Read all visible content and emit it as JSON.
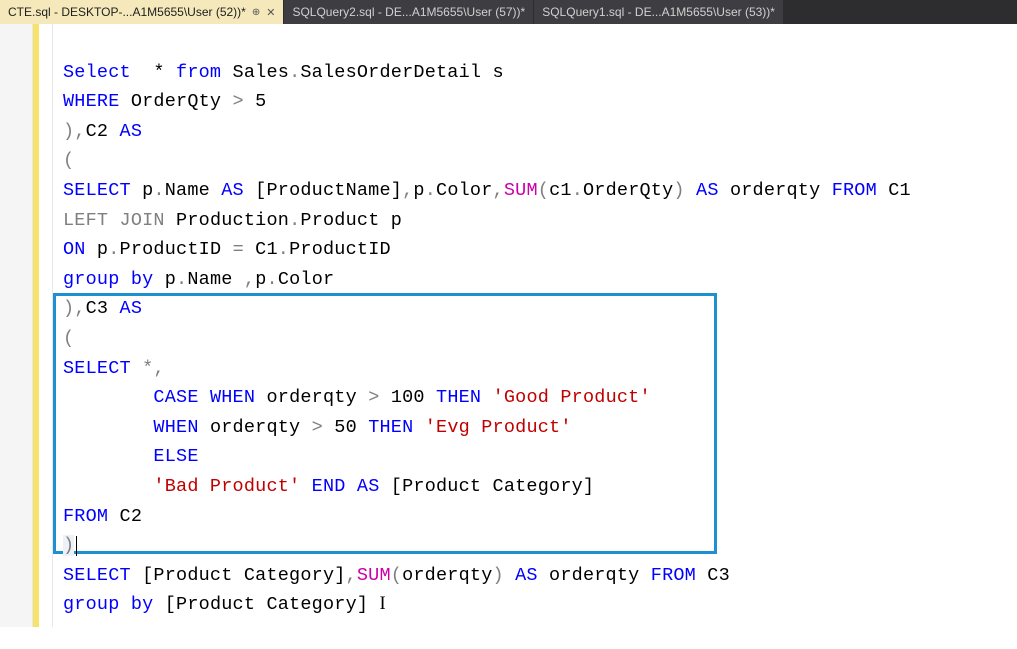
{
  "tabs": [
    {
      "label": "CTE.sql - DESKTOP-...A1M5655\\User (52))*",
      "active": true,
      "pinned": true,
      "closable": true
    },
    {
      "label": "SQLQuery2.sql - DE...A1M5655\\User (57))*",
      "active": false,
      "pinned": false,
      "closable": false
    },
    {
      "label": "SQLQuery1.sql - DE...A1M5655\\User (53))*",
      "active": false,
      "pinned": false,
      "closable": false
    }
  ],
  "code": {
    "l0": {
      "a": "Select",
      "b": "  * ",
      "c": "from",
      "d": " Sales",
      "e": ".",
      "f": "SalesOrderDetail s"
    },
    "l1": {
      "a": "WHERE",
      "b": " OrderQty ",
      "c": ">",
      "d": " 5"
    },
    "l2": {
      "a": ")",
      "b": ",",
      "c": "C2 ",
      "d": "AS"
    },
    "l3": {
      "a": "("
    },
    "l4": {
      "a": "SELECT",
      "b": " p",
      "c": ".",
      "d": "Name ",
      "e": "AS",
      "f": " [ProductName]",
      "g": ",",
      "h": "p",
      "i": ".",
      "j": "Color",
      "k": ",",
      "l": "SUM",
      "m": "(",
      "n": "c1",
      "o": ".",
      "p": "OrderQty",
      "q": ")",
      "r": " ",
      "s": "AS",
      "t": " orderqty ",
      "u": "FROM",
      "v": " C1"
    },
    "l5": {
      "a": "LEFT",
      "b": " ",
      "c": "JOIN",
      "d": " Production",
      "e": ".",
      "f": "Product p"
    },
    "l6": {
      "a": "ON",
      "b": " p",
      "c": ".",
      "d": "ProductID ",
      "e": "=",
      "f": " C1",
      "g": ".",
      "h": "ProductID"
    },
    "l7": {
      "a": "group",
      "b": " ",
      "c": "by",
      "d": " p",
      "e": ".",
      "f": "Name ",
      "g": ",",
      "h": "p",
      "i": ".",
      "j": "Color"
    },
    "l8": {
      "a": ")",
      "b": ",",
      "c": "C3 ",
      "d": "AS"
    },
    "l9": {
      "a": "("
    },
    "l10": {
      "a": "SELECT",
      "b": " ",
      "c": "*",
      "d": ","
    },
    "l11": {
      "a": "        ",
      "b": "CASE",
      "c": " ",
      "d": "WHEN",
      "e": " orderqty ",
      "f": ">",
      "g": " 100 ",
      "h": "THEN",
      "i": " ",
      "j": "'Good Product'"
    },
    "l12": {
      "a": "        ",
      "b": "WHEN",
      "c": " orderqty ",
      "d": ">",
      "e": " 50 ",
      "f": "THEN",
      "g": " ",
      "h": "'Evg Product'"
    },
    "l13": {
      "a": "        ",
      "b": "ELSE"
    },
    "l14": {
      "a": "        ",
      "b": "'Bad Product'",
      "c": " ",
      "d": "END",
      "e": " ",
      "f": "AS",
      "g": " [Product Category]"
    },
    "l15": {
      "a": "FROM",
      "b": " C2"
    },
    "l16": {
      "a": ")"
    },
    "l17": {
      "a": "SELECT",
      "b": " [Product Category]",
      "c": ",",
      "d": "SUM",
      "e": "(",
      "f": "orderqty",
      "g": ")",
      "h": " ",
      "i": "AS",
      "j": " orderqty ",
      "k": "FROM",
      "l": " C3"
    },
    "l18": {
      "a": "group",
      "b": " ",
      "c": "by",
      "d": " [Product Category] "
    }
  }
}
